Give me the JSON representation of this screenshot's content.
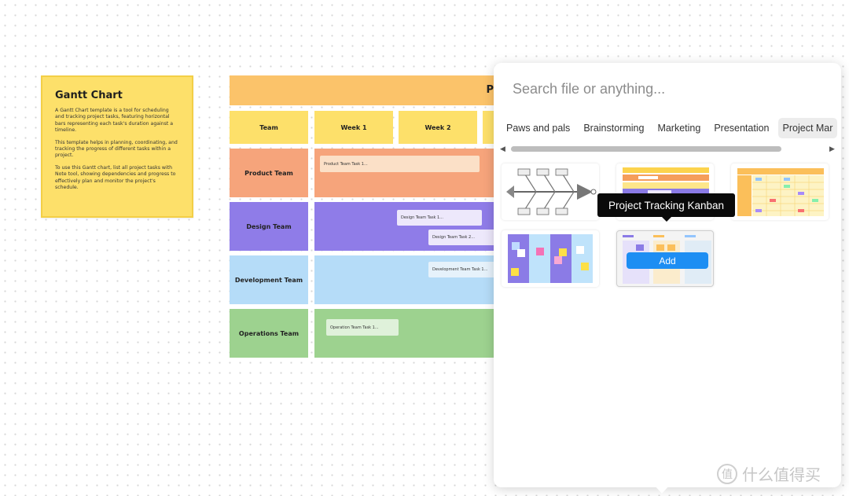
{
  "note": {
    "title": "Gantt Chart",
    "para1": "A Gantt Chart template is a tool for scheduling and tracking project tasks, featuring horizontal bars representing each task's duration against a timeline.",
    "para2": "This template helps in planning, coordinating, and tracking the progress of different tasks within a project.",
    "para3": "To use this Gantt chart, list all project tasks with Note tool, showing dependencies and progress to effectively plan and monitor the project's schedule."
  },
  "gantt": {
    "title_visible": "P",
    "headers": {
      "team": "Team",
      "week1": "Week 1",
      "week2": "Week 2"
    },
    "teams": [
      "Product Team",
      "Design Team",
      "Development Team",
      "Operations Team"
    ],
    "tasks": {
      "product1": "Product Team Task 1...",
      "design1": "Design Team Task 1...",
      "design2": "Design Team Task 2...",
      "dev1": "Development Team Task 1...",
      "ops1": "Operation Team Task 1..."
    },
    "colors": {
      "title": "#fbc36a",
      "header": "#fde06a",
      "product": "#f6a47b",
      "design": "#8f7ce8",
      "development": "#b5dcf8",
      "operations": "#9dd28f"
    }
  },
  "panel": {
    "search_placeholder": "Search file or anything...",
    "categories": [
      "Paws and pals",
      "Brainstorming",
      "Marketing",
      "Presentation",
      "Project Mar"
    ],
    "active_category": "Project Mar",
    "tooltip": "Project Tracking Kanban",
    "add_label": "Add",
    "accent": "#1d8ef3"
  },
  "watermark": {
    "text": "什么值得买",
    "logo": "值"
  }
}
